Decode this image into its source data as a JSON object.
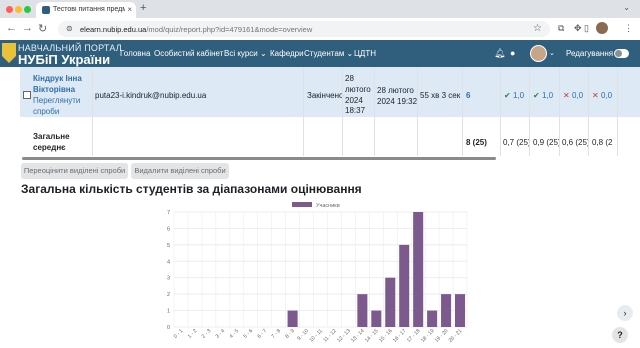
{
  "browser": {
    "tab_title": "Тестові питання предметної",
    "new_tab": "+",
    "url_host": "elearn.nubip.edu.ua",
    "url_path": "/mod/quiz/report.php?id=479161&mode=overview"
  },
  "site": {
    "logo_line1": "НАВЧАЛЬНИЙ ПОРТАЛ",
    "logo_line2": "НУБіП України",
    "nav": [
      "Головна",
      "Особистий кабінет",
      "Всі курси",
      "Кафедри",
      "Студентам",
      "ЦДТН"
    ],
    "edit_label": "Редагування"
  },
  "table": {
    "row": {
      "name": "Кіндрук Інна Вікторівна",
      "review": "Переглянути спроби",
      "email": "puta23-i.kindruk@nubip.edu.ua",
      "status": "Закінчено",
      "started": "28 лютого 2024 18:37",
      "finished": "28 лютого 2024 19:32",
      "duration": "55 хв 3 сек",
      "grade": "6",
      "q": [
        {
          "mark": "✔",
          "value": "1,0",
          "status": "ok"
        },
        {
          "mark": "✔",
          "value": "1,0",
          "status": "ok"
        },
        {
          "mark": "✕",
          "value": "0,0",
          "status": "bad"
        },
        {
          "mark": "✕",
          "value": "0,0",
          "status": "bad"
        }
      ]
    },
    "avg": {
      "label": "Загальне середнє",
      "grade": "8 (25)",
      "q": [
        "0,7 (25)",
        "0,9 (25)",
        "0,6 (25)",
        "0,8 (2"
      ]
    }
  },
  "buttons": {
    "regrade": "Переоцінити виділені спроби",
    "delete": "Видалити виділені спроби"
  },
  "section_title": "Загальна кількість студентів за діапазонами оцінювання",
  "chart_data": {
    "type": "bar",
    "legend": "Учасники",
    "color": "#7c5a8e",
    "categories": [
      "0 - 1",
      "1 - 2",
      "2 - 3",
      "3 - 4",
      "4 - 5",
      "5 - 6",
      "6 - 7",
      "7 - 8",
      "8 - 9",
      "9 - 10",
      "10 - 11",
      "11 - 12",
      "12 - 13",
      "13 - 14",
      "14 - 15",
      "15 - 16",
      "16 - 17",
      "17 - 18",
      "18 - 19",
      "19 - 20",
      "20 - 21"
    ],
    "tick_labels": [
      "0 - 1",
      "1 - 2",
      "2 - 3",
      "3 - 4",
      "4 - 5",
      "5 - 6",
      "6 - 7",
      "7 - 8",
      "8 - 9",
      "9 - 10",
      "10 - 11",
      "11 - 12",
      "12 - 13",
      "13 - 14",
      "14 - 15",
      "15 - 16",
      "16 - 17",
      "17 - 18",
      "18 - 19",
      "19 - 20",
      "20 - 21"
    ],
    "values": [
      0,
      0,
      0,
      0,
      0,
      0,
      0,
      0,
      1,
      0,
      0,
      0,
      0,
      2,
      1,
      3,
      5,
      7,
      1,
      2,
      2
    ],
    "ylim": [
      0,
      7
    ],
    "yticks": [
      0,
      1,
      2,
      3,
      4,
      5,
      6,
      7
    ],
    "grid": true,
    "legend_position": "top"
  },
  "side": {
    "expand": "›",
    "help": "?"
  }
}
